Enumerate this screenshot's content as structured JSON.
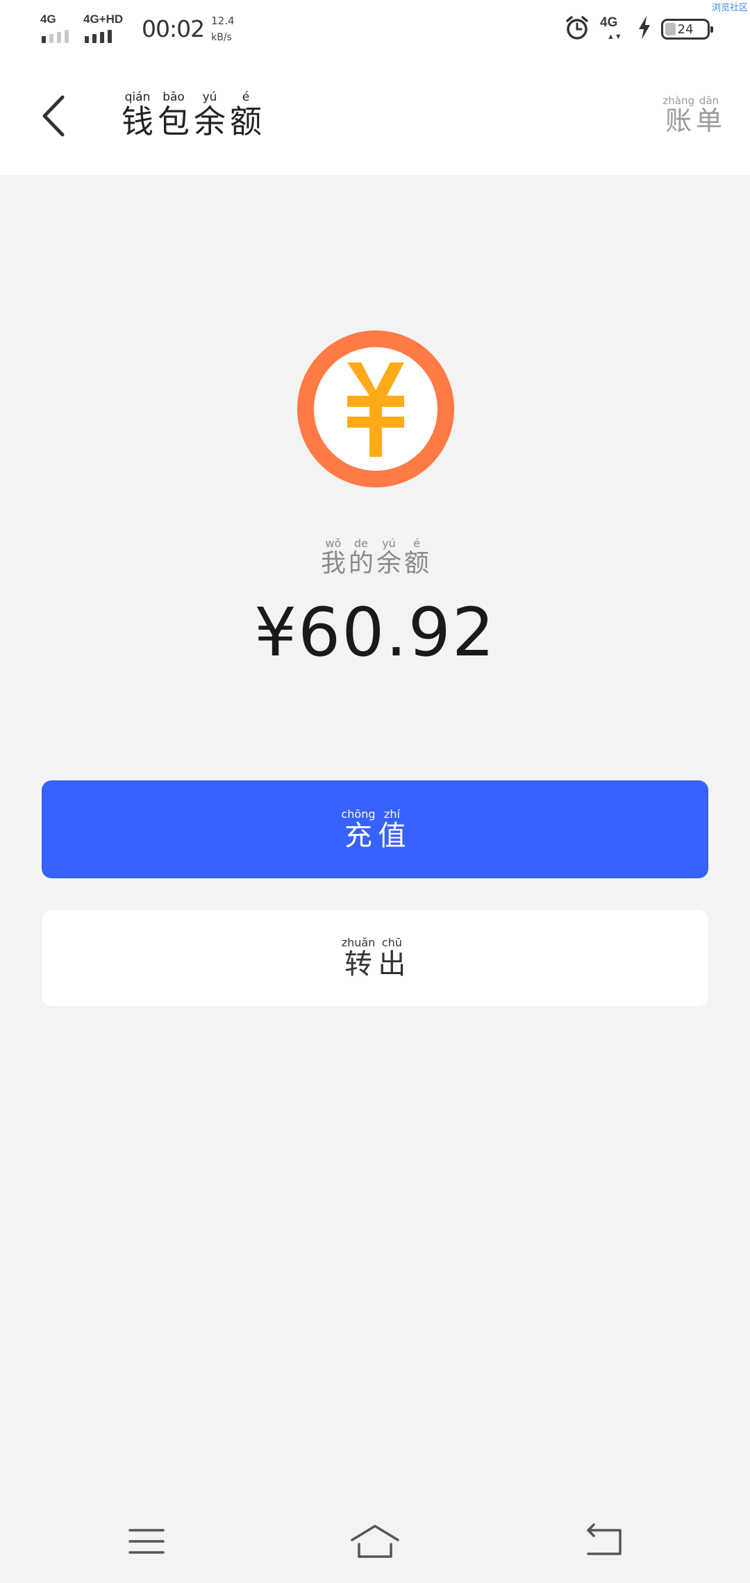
{
  "status_bar": {
    "net1": "4G",
    "net2": "4G+HD",
    "time": "00:02",
    "speed_value": "12.4",
    "speed_unit": "kB/s",
    "net_right": "4G",
    "battery": "24",
    "corner_tag": "浏览社区"
  },
  "header": {
    "back_icon": "chevron-left-icon",
    "title": [
      {
        "py": "qián",
        "hz": "钱"
      },
      {
        "py": "bāo",
        "hz": "包"
      },
      {
        "py": "yú",
        "hz": "余"
      },
      {
        "py": "é",
        "hz": "额"
      }
    ],
    "bill": [
      {
        "py": "zhàng",
        "hz": "账"
      },
      {
        "py": "dān",
        "hz": "单"
      }
    ]
  },
  "balance": {
    "coin_icon": "yuan-coin-icon",
    "coin_symbol": "¥",
    "label": [
      {
        "py": "wǒ",
        "hz": "我"
      },
      {
        "py": "de",
        "hz": "的"
      },
      {
        "py": "yú",
        "hz": "余"
      },
      {
        "py": "é",
        "hz": "额"
      }
    ],
    "amount": "¥60.92"
  },
  "actions": {
    "recharge": [
      {
        "py": "chōng",
        "hz": "充"
      },
      {
        "py": "zhí",
        "hz": "值"
      }
    ],
    "withdraw": [
      {
        "py": "zhuǎn",
        "hz": "转"
      },
      {
        "py": "chū",
        "hz": "出"
      }
    ]
  },
  "nav": {
    "menu_icon": "menu-icon",
    "home_icon": "home-icon",
    "back_icon": "back-icon"
  },
  "colors": {
    "accent": "#3762ff",
    "coin_ring": "#ff7a45",
    "coin_symbol": "#ffab19",
    "background": "#f3f3f3"
  }
}
